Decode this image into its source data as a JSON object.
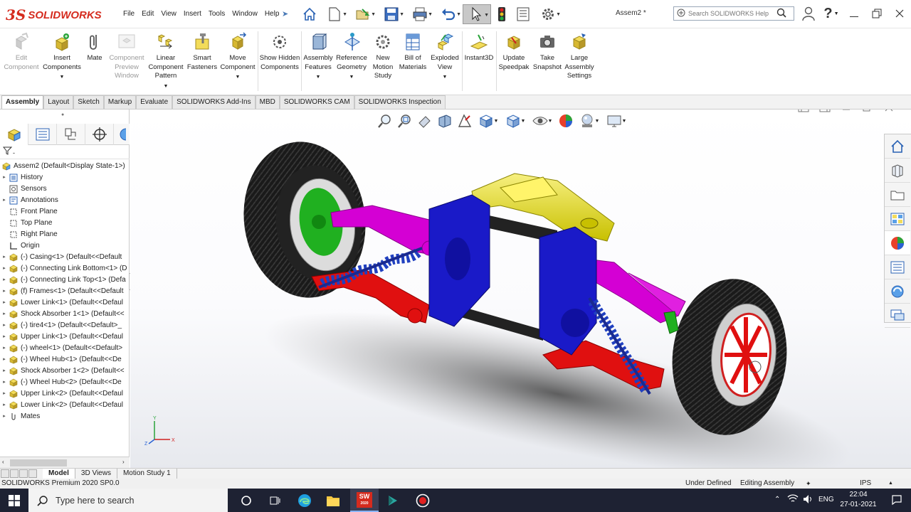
{
  "app": {
    "name": "SOLIDWORKS",
    "logo_mark": "3S",
    "document_title": "Assem2 *"
  },
  "menu": [
    "File",
    "Edit",
    "View",
    "Insert",
    "Tools",
    "Window",
    "Help"
  ],
  "search": {
    "placeholder": "Search SOLIDWORKS Help"
  },
  "ribbon": {
    "edit_component": "Edit Component",
    "insert_components": "Insert Components",
    "mate": "Mate",
    "component_preview": "Component Preview Window",
    "linear_pattern": "Linear Component Pattern",
    "smart_fasteners": "Smart Fasteners",
    "move_component": "Move Component",
    "show_hidden": "Show Hidden Components",
    "assembly_features": "Assembly Features",
    "reference_geometry": "Reference Geometry",
    "new_motion_study": "New Motion Study",
    "bill_of_materials": "Bill of Materials",
    "exploded_view": "Exploded View",
    "instant3d": "Instant3D",
    "update_speedpak": "Update Speedpak",
    "take_snapshot": "Take Snapshot",
    "large_assembly": "Large Assembly Settings"
  },
  "tabs": [
    "Assembly",
    "Layout",
    "Sketch",
    "Markup",
    "Evaluate",
    "SOLIDWORKS Add-Ins",
    "MBD",
    "SOLIDWORKS CAM",
    "SOLIDWORKS Inspection"
  ],
  "active_tab": "Assembly",
  "tree": {
    "root": "Assem2  (Default<Display State-1>)",
    "items": [
      {
        "label": "History",
        "icon": "history-icon",
        "expand": true
      },
      {
        "label": "Sensors",
        "icon": "sensors-icon",
        "expand": false
      },
      {
        "label": "Annotations",
        "icon": "annotations-icon",
        "expand": true
      },
      {
        "label": "Front Plane",
        "icon": "plane-icon",
        "expand": false
      },
      {
        "label": "Top Plane",
        "icon": "plane-icon",
        "expand": false
      },
      {
        "label": "Right Plane",
        "icon": "plane-icon",
        "expand": false
      },
      {
        "label": "Origin",
        "icon": "origin-icon",
        "expand": false
      },
      {
        "label": "(-) Casing<1> (Default<<Default",
        "icon": "part-icon",
        "expand": true
      },
      {
        "label": "(-) Connecting Link Bottom<1> (D",
        "icon": "part-icon",
        "expand": true
      },
      {
        "label": "(-) Connecting Link Top<1> (Defa",
        "icon": "part-icon",
        "expand": true
      },
      {
        "label": "(f) Frames<1> (Default<<Default",
        "icon": "part-icon",
        "expand": true
      },
      {
        "label": "Lower Link<1> (Default<<Defaul",
        "icon": "part-icon",
        "expand": true
      },
      {
        "label": "Shock Absorber 1<1> (Default<<",
        "icon": "part-icon",
        "expand": true
      },
      {
        "label": "(-) tire4<1> (Default<<Default>_",
        "icon": "part-icon",
        "expand": true
      },
      {
        "label": "Upper Link<1> (Default<<Defaul",
        "icon": "part-icon",
        "expand": true
      },
      {
        "label": "(-) wheel<1> (Default<<Default>",
        "icon": "part-icon",
        "expand": true
      },
      {
        "label": "(-) Wheel Hub<1> (Default<<De",
        "icon": "part-icon",
        "expand": true
      },
      {
        "label": "Shock Absorber 1<2> (Default<<",
        "icon": "part-icon",
        "expand": true
      },
      {
        "label": "(-) Wheel Hub<2> (Default<<De",
        "icon": "part-icon",
        "expand": true
      },
      {
        "label": "Upper Link<2> (Default<<Defaul",
        "icon": "part-icon",
        "expand": true
      },
      {
        "label": "Lower Link<2> (Default<<Defaul",
        "icon": "part-icon",
        "expand": true
      },
      {
        "label": "Mates",
        "icon": "mates-icon",
        "expand": true
      }
    ]
  },
  "bottom_tabs": [
    "Model",
    "3D Views",
    "Motion Study 1"
  ],
  "status": {
    "version": "SOLIDWORKS Premium 2020 SP0.0",
    "state": "Under Defined",
    "mode": "Editing Assembly",
    "units": "IPS"
  },
  "triad": {
    "x": "X",
    "y": "Y",
    "z": "Z"
  },
  "taskbar": {
    "search": "Type here to search",
    "lang": "ENG",
    "time": "22:04",
    "date": "27-01-2021",
    "sw_badge": "SW",
    "sw_year": "2020"
  },
  "colors": {
    "accent": "#d52b1e",
    "link_magenta": "#d400d4",
    "casing_blue": "#1a1ac8",
    "lower_red": "#e01010",
    "frame_yellow": "#e8e000",
    "spring_blue": "#2040c0",
    "hub_green": "#20b020",
    "taskbar": "#1e2233"
  }
}
